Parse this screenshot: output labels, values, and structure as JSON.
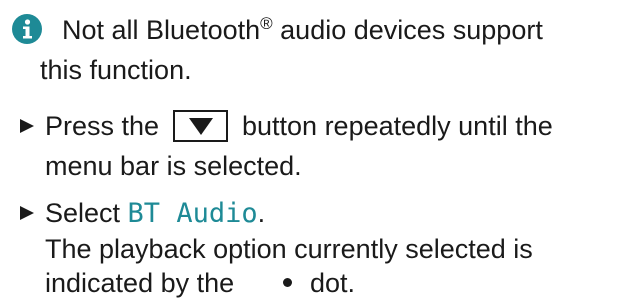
{
  "note": {
    "icon": "info-icon",
    "line1_part1": "Not all Bluetooth",
    "registered_mark": "®",
    "line1_part2": " audio devices support",
    "line2": "this function."
  },
  "steps": [
    {
      "icon": "triangle-bullet-icon",
      "line1_before": "Press the",
      "button_icon": "down-triangle-icon",
      "line1_after": "button repeatedly until the",
      "line2": "menu bar is selected."
    },
    {
      "icon": "triangle-bullet-icon",
      "line1_before": "Select ",
      "menu_item": "BT Audio",
      "line1_after": ".",
      "line2": "The playback option currently selected is",
      "line3_before": "indicated by the",
      "line3_after": "dot."
    }
  ],
  "colors": {
    "accent": "#1e8a96",
    "text": "#1a1a1a"
  }
}
